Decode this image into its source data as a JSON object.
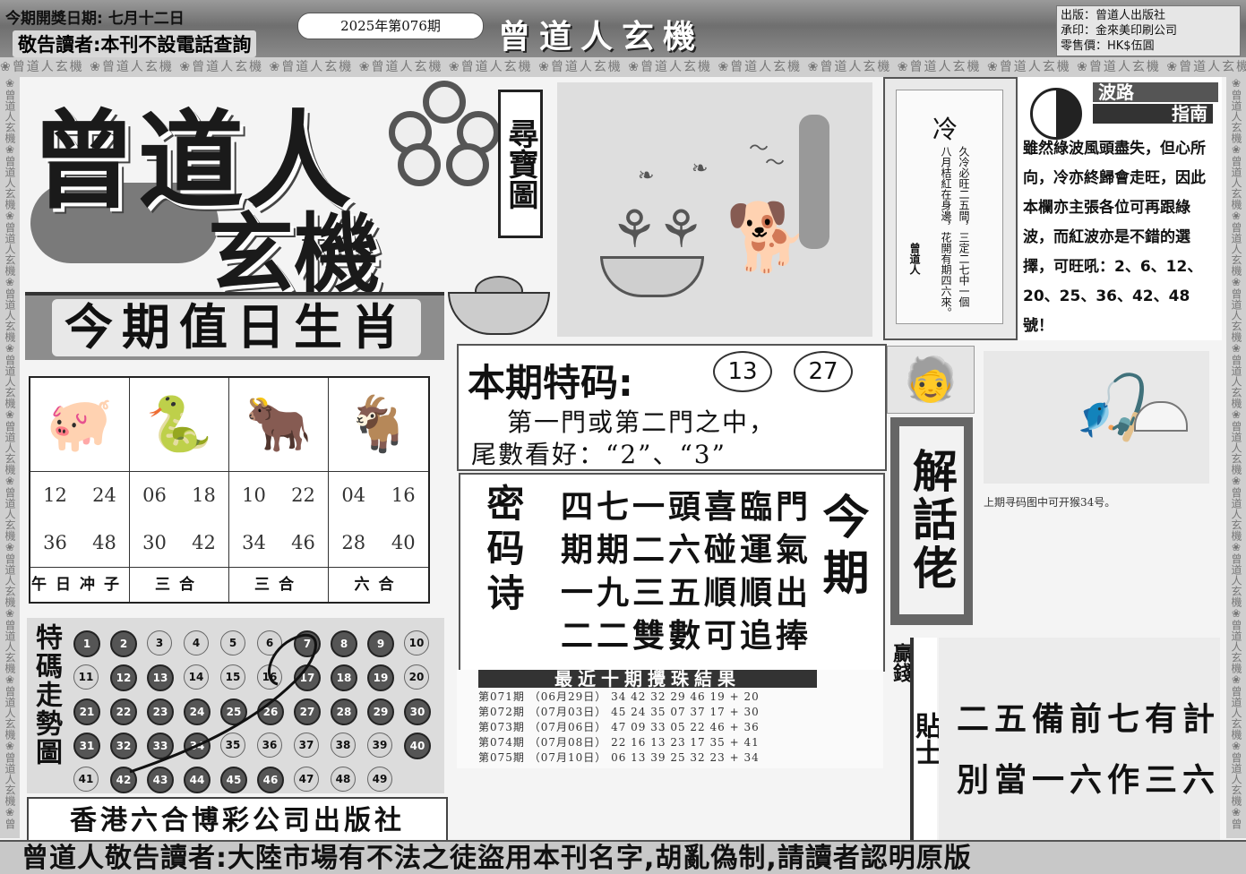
{
  "header": {
    "draw_date_label": "今期開獎日期:",
    "draw_date": "七月十二日",
    "notice": "敬告讀者:本刊不設電話查詢",
    "issue": "2025年第076期",
    "brand": "曾道人玄機",
    "publisher_lines": [
      "出版：曾道人出版社",
      "承印：金來美印刷公司",
      "零售價：HK$伍圓"
    ]
  },
  "watermark": "曾道人玄機",
  "logo": {
    "line1": "曾道人",
    "line2": "玄機",
    "hunt_label": "尋寶圖"
  },
  "zodiac_section": {
    "title": "今期值日生肖",
    "columns": [
      {
        "icon": "pig-icon",
        "glyph": "🐖",
        "numbers": [
          "12",
          "24",
          "36",
          "48"
        ],
        "label": "午日冲子"
      },
      {
        "icon": "snake-icon",
        "glyph": "🐍",
        "numbers": [
          "06",
          "18",
          "30",
          "42"
        ],
        "label": "三合"
      },
      {
        "icon": "ox-icon",
        "glyph": "🐂",
        "numbers": [
          "10",
          "22",
          "34",
          "46"
        ],
        "label": "三合"
      },
      {
        "icon": "goat-icon",
        "glyph": "🐐",
        "numbers": [
          "04",
          "16",
          "28",
          "40"
        ],
        "label": "六合"
      }
    ]
  },
  "trend": {
    "title": "特碼走勢圖",
    "balls": [
      "1",
      "2",
      "3",
      "4",
      "5",
      "6",
      "7",
      "8",
      "9",
      "10",
      "11",
      "12",
      "13",
      "14",
      "15",
      "16",
      "17",
      "18",
      "19",
      "20",
      "21",
      "22",
      "23",
      "24",
      "25",
      "26",
      "27",
      "28",
      "29",
      "30",
      "31",
      "32",
      "33",
      "34",
      "35",
      "36",
      "37",
      "38",
      "39",
      "40",
      "41",
      "42",
      "43",
      "44",
      "45",
      "46",
      "47",
      "48",
      "49"
    ],
    "light": [
      "3",
      "4",
      "5",
      "6",
      "10",
      "11",
      "14",
      "15",
      "16",
      "20",
      "35",
      "36",
      "37",
      "38",
      "39",
      "41",
      "47",
      "48",
      "49"
    ]
  },
  "publisher_footer": "香港六合博彩公司出版社",
  "poem_card": {
    "big": "冷",
    "col1": "久冷必旺二五間，三定二七中一個",
    "col2": "八月桔紅在身邊，花開有期四六來。",
    "author": "曾道人"
  },
  "wave_guide": {
    "title1": "波路",
    "title2": "指南",
    "body": "雖然綠波風頭盡失，但心所向，冷亦終歸會走旺，因此本欄亦主張各位可再跟綠波，而紅波亦是不錯的選擇，可旺吼：2、6、12、20、25、36、42、48號！"
  },
  "special_code": {
    "title": "本期特码:",
    "numbers": [
      "13",
      "27"
    ],
    "line1": "第一門或第二門之中，",
    "line2": "尾數看好：“2”、“3”"
  },
  "secret_poem": {
    "left_title": "密码诗",
    "lines": [
      "四七一頭喜臨門",
      "期期二六碰運氣",
      "一九三五順順出",
      "二二雙數可追捧"
    ],
    "right_title": "今期"
  },
  "results": {
    "title": "最近十期攪珠結果",
    "rows": [
      {
        "issue": "第071期",
        "date": "（06月29日）",
        "nums": "34 42 32 29 46 19 + 20"
      },
      {
        "issue": "第072期",
        "date": "（07月03日）",
        "nums": "45 24 35 07 37 17 + 30"
      },
      {
        "issue": "第073期",
        "date": "（07月06日）",
        "nums": "47 09 33 05 22 46 + 36"
      },
      {
        "issue": "第074期",
        "date": "（07月08日）",
        "nums": "22 16 13 23 17 35 + 41"
      },
      {
        "issue": "第075期",
        "date": "（07月10日）",
        "nums": "06 13 39 25 32 23 + 34"
      }
    ]
  },
  "explainer": {
    "title": "解話佬",
    "caption": "上期寻码图中可开猴34号。"
  },
  "tips": {
    "side_a": "贏錢",
    "side_b": "貼士",
    "line1": "二五備前七有計",
    "line2": "別當一六作三六"
  },
  "footer": "曾道人敬告讀者:大陸市場有不法之徒盜用本刊名字,胡亂偽制,請讀者認明原版"
}
